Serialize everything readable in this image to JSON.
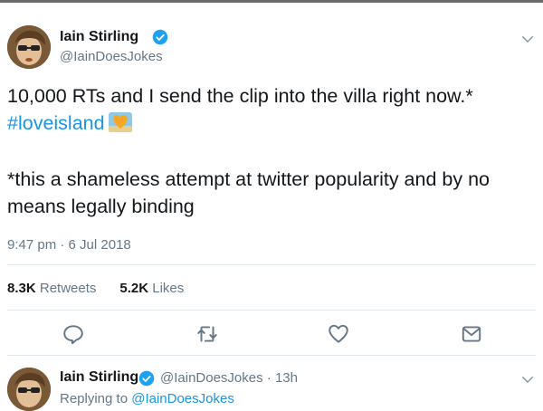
{
  "tweet": {
    "author_name": "Iain Stirling",
    "author_handle": "@IainDoesJokes",
    "text_line1": "10,000 RTs and I send the clip into the villa right now.*",
    "hashtag": "#loveisland",
    "text_line3": "*this a shameless attempt at twitter popularity and by no",
    "text_line4": "means legally binding",
    "timestamp": "9:47 pm · 6 Jul 2018",
    "retweets_count": "8.3K",
    "retweets_label": "Retweets",
    "likes_count": "5.2K",
    "likes_label": "Likes"
  },
  "actions": {
    "reply_icon": "comment-icon",
    "retweet_icon": "retweet-icon",
    "like_icon": "heart-icon",
    "share_icon": "share-icon"
  },
  "reply": {
    "author_name": "Iain Stirling",
    "author_handle": "@IainDoesJokes",
    "separator": "·",
    "time_ago": "13h",
    "replying_to_label": "Replying to",
    "replying_to_handle": "@IainDoesJokes"
  },
  "colors": {
    "link": "#1b95e0",
    "muted": "#657786",
    "text": "#14171a",
    "divider": "#e1e8ed",
    "verified": "#1da1f2"
  }
}
